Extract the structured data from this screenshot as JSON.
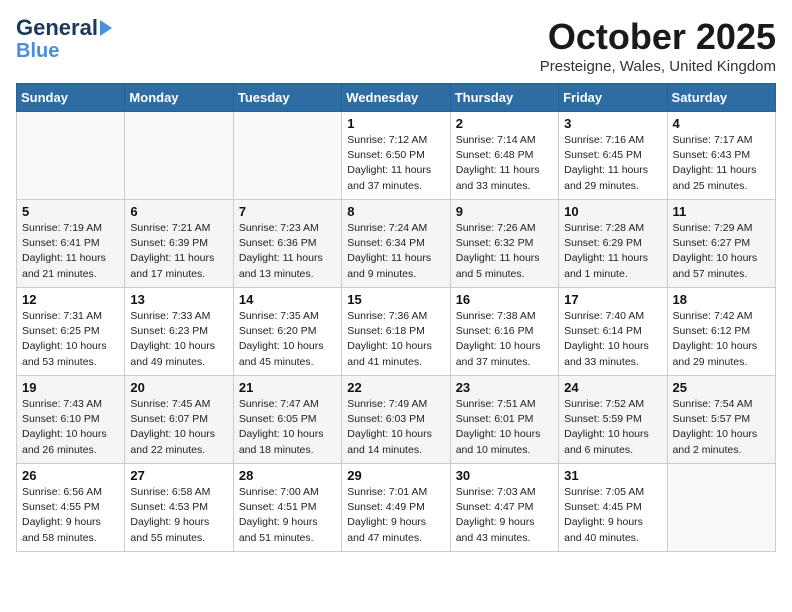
{
  "header": {
    "logo_line1": "General",
    "logo_line2": "Blue",
    "month": "October 2025",
    "location": "Presteigne, Wales, United Kingdom"
  },
  "weekdays": [
    "Sunday",
    "Monday",
    "Tuesday",
    "Wednesday",
    "Thursday",
    "Friday",
    "Saturday"
  ],
  "weeks": [
    [
      {
        "day": "",
        "info": ""
      },
      {
        "day": "",
        "info": ""
      },
      {
        "day": "",
        "info": ""
      },
      {
        "day": "1",
        "info": "Sunrise: 7:12 AM\nSunset: 6:50 PM\nDaylight: 11 hours\nand 37 minutes."
      },
      {
        "day": "2",
        "info": "Sunrise: 7:14 AM\nSunset: 6:48 PM\nDaylight: 11 hours\nand 33 minutes."
      },
      {
        "day": "3",
        "info": "Sunrise: 7:16 AM\nSunset: 6:45 PM\nDaylight: 11 hours\nand 29 minutes."
      },
      {
        "day": "4",
        "info": "Sunrise: 7:17 AM\nSunset: 6:43 PM\nDaylight: 11 hours\nand 25 minutes."
      }
    ],
    [
      {
        "day": "5",
        "info": "Sunrise: 7:19 AM\nSunset: 6:41 PM\nDaylight: 11 hours\nand 21 minutes."
      },
      {
        "day": "6",
        "info": "Sunrise: 7:21 AM\nSunset: 6:39 PM\nDaylight: 11 hours\nand 17 minutes."
      },
      {
        "day": "7",
        "info": "Sunrise: 7:23 AM\nSunset: 6:36 PM\nDaylight: 11 hours\nand 13 minutes."
      },
      {
        "day": "8",
        "info": "Sunrise: 7:24 AM\nSunset: 6:34 PM\nDaylight: 11 hours\nand 9 minutes."
      },
      {
        "day": "9",
        "info": "Sunrise: 7:26 AM\nSunset: 6:32 PM\nDaylight: 11 hours\nand 5 minutes."
      },
      {
        "day": "10",
        "info": "Sunrise: 7:28 AM\nSunset: 6:29 PM\nDaylight: 11 hours\nand 1 minute."
      },
      {
        "day": "11",
        "info": "Sunrise: 7:29 AM\nSunset: 6:27 PM\nDaylight: 10 hours\nand 57 minutes."
      }
    ],
    [
      {
        "day": "12",
        "info": "Sunrise: 7:31 AM\nSunset: 6:25 PM\nDaylight: 10 hours\nand 53 minutes."
      },
      {
        "day": "13",
        "info": "Sunrise: 7:33 AM\nSunset: 6:23 PM\nDaylight: 10 hours\nand 49 minutes."
      },
      {
        "day": "14",
        "info": "Sunrise: 7:35 AM\nSunset: 6:20 PM\nDaylight: 10 hours\nand 45 minutes."
      },
      {
        "day": "15",
        "info": "Sunrise: 7:36 AM\nSunset: 6:18 PM\nDaylight: 10 hours\nand 41 minutes."
      },
      {
        "day": "16",
        "info": "Sunrise: 7:38 AM\nSunset: 6:16 PM\nDaylight: 10 hours\nand 37 minutes."
      },
      {
        "day": "17",
        "info": "Sunrise: 7:40 AM\nSunset: 6:14 PM\nDaylight: 10 hours\nand 33 minutes."
      },
      {
        "day": "18",
        "info": "Sunrise: 7:42 AM\nSunset: 6:12 PM\nDaylight: 10 hours\nand 29 minutes."
      }
    ],
    [
      {
        "day": "19",
        "info": "Sunrise: 7:43 AM\nSunset: 6:10 PM\nDaylight: 10 hours\nand 26 minutes."
      },
      {
        "day": "20",
        "info": "Sunrise: 7:45 AM\nSunset: 6:07 PM\nDaylight: 10 hours\nand 22 minutes."
      },
      {
        "day": "21",
        "info": "Sunrise: 7:47 AM\nSunset: 6:05 PM\nDaylight: 10 hours\nand 18 minutes."
      },
      {
        "day": "22",
        "info": "Sunrise: 7:49 AM\nSunset: 6:03 PM\nDaylight: 10 hours\nand 14 minutes."
      },
      {
        "day": "23",
        "info": "Sunrise: 7:51 AM\nSunset: 6:01 PM\nDaylight: 10 hours\nand 10 minutes."
      },
      {
        "day": "24",
        "info": "Sunrise: 7:52 AM\nSunset: 5:59 PM\nDaylight: 10 hours\nand 6 minutes."
      },
      {
        "day": "25",
        "info": "Sunrise: 7:54 AM\nSunset: 5:57 PM\nDaylight: 10 hours\nand 2 minutes."
      }
    ],
    [
      {
        "day": "26",
        "info": "Sunrise: 6:56 AM\nSunset: 4:55 PM\nDaylight: 9 hours\nand 58 minutes."
      },
      {
        "day": "27",
        "info": "Sunrise: 6:58 AM\nSunset: 4:53 PM\nDaylight: 9 hours\nand 55 minutes."
      },
      {
        "day": "28",
        "info": "Sunrise: 7:00 AM\nSunset: 4:51 PM\nDaylight: 9 hours\nand 51 minutes."
      },
      {
        "day": "29",
        "info": "Sunrise: 7:01 AM\nSunset: 4:49 PM\nDaylight: 9 hours\nand 47 minutes."
      },
      {
        "day": "30",
        "info": "Sunrise: 7:03 AM\nSunset: 4:47 PM\nDaylight: 9 hours\nand 43 minutes."
      },
      {
        "day": "31",
        "info": "Sunrise: 7:05 AM\nSunset: 4:45 PM\nDaylight: 9 hours\nand 40 minutes."
      },
      {
        "day": "",
        "info": ""
      }
    ]
  ]
}
